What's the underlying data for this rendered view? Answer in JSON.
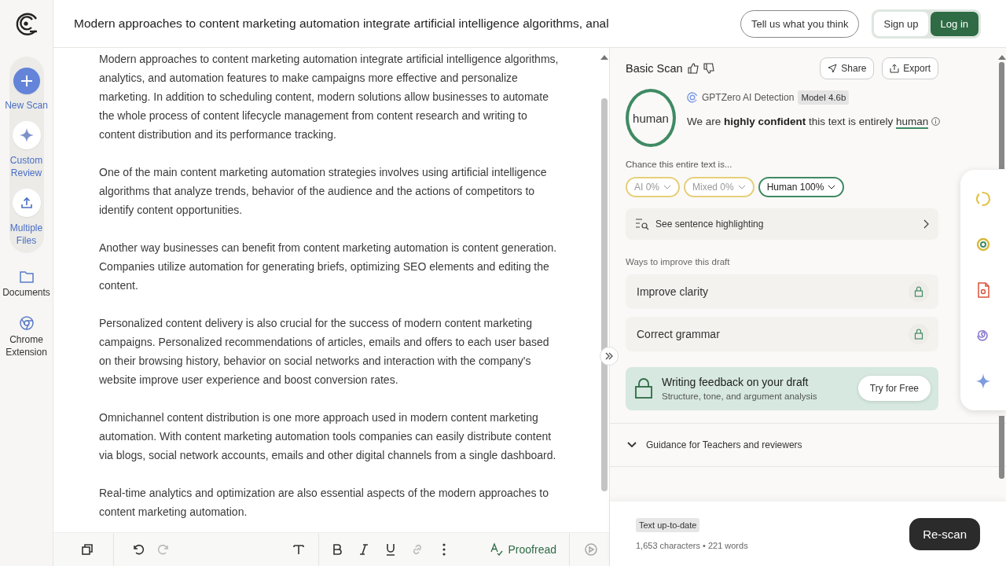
{
  "sidebar": {
    "tools": [
      {
        "label": "New Scan",
        "selected": true
      },
      {
        "label": "Custom Review",
        "selected": false
      },
      {
        "label": "Multiple Files",
        "selected": false
      }
    ],
    "links": [
      {
        "label": "Documents"
      },
      {
        "label": "Chrome Extension"
      }
    ]
  },
  "header": {
    "document_title": "Modern approaches to content marketing automation integrate artificial intelligence algorithms, anal",
    "feedback_button": "Tell us what you think",
    "signup_button": "Sign up",
    "login_button": "Log in"
  },
  "editor": {
    "paragraphs": [
      "Modern approaches to content marketing automation integrate artificial intelligence algorithms, analytics, and automation features to make campaigns more effective and personalize marketing. In addition to scheduling content, modern solutions allow businesses to automate the whole process of content lifecycle management from content research and writing to content distribution and its performance tracking.",
      "One of the main content marketing automation strategies involves using artificial intelligence algorithms that analyze trends, behavior of the audience and the actions of competitors to identify content opportunities.",
      "Another way businesses can benefit from content marketing automation is content generation. Companies utilize automation for generating briefs, optimizing SEO elements and editing the content.",
      "Personalized content delivery is also crucial for the success of modern content marketing campaigns. Personalized recommendations of articles, emails and offers to each user based on their browsing history, behavior on social networks and interaction with the company's website improve user experience and boost conversion rates.",
      "Omnichannel content distribution is one more approach used in modern content marketing automation. With content marketing automation tools companies can easily distribute content via blogs, social network accounts, emails and other digital channels from a single dashboard.",
      "Real-time analytics and optimization are also essential aspects of the modern approaches to content marketing automation."
    ],
    "toolbar": {
      "proofread_button": "Proofread"
    }
  },
  "result": {
    "title": "Basic Scan",
    "share_button": "Share",
    "export_button": "Export",
    "verdict": "human",
    "detector": "GPTZero AI Detection",
    "model_badge": "Model 4.6b",
    "statement": "We are **highly confident** this text is entirely ",
    "statement_verdict": "human",
    "chance_label": "Chance this entire text is...",
    "chances": [
      {
        "label": "AI 0%",
        "color": "#e6cf7a",
        "selected": false
      },
      {
        "label": "Mixed 0%",
        "color": "#e6cf7a",
        "selected": false
      },
      {
        "label": "Human 100%",
        "color": "#3f8a64",
        "selected": true
      }
    ],
    "highlighting_button": "See sentence highlighting",
    "improve_label": "Ways to improve this draft",
    "improvements": [
      {
        "label": "Improve clarity",
        "locked": true
      },
      {
        "label": "Correct grammar",
        "locked": true
      }
    ],
    "promo": {
      "title": "Writing feedback on your draft",
      "subtitle": "Structure, tone, and argument analysis",
      "button": "Try for Free"
    },
    "guidance": "Guidance for Teachers and reviewers",
    "status_badge": "Text up-to-date",
    "counts": "1,653 characters • 221 words",
    "rescan_button": "Re-scan"
  }
}
